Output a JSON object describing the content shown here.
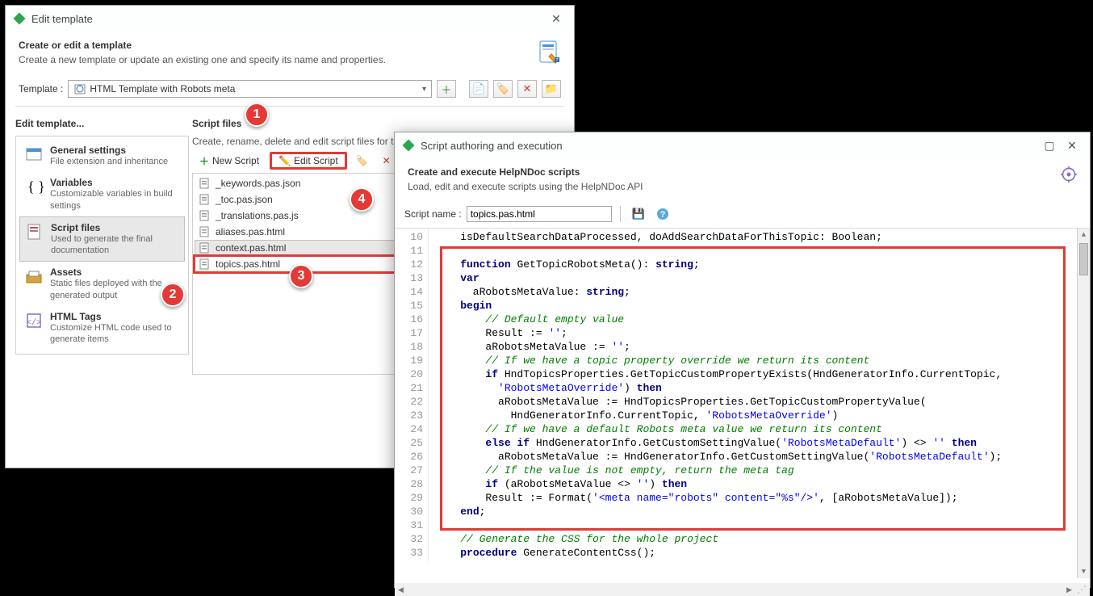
{
  "window1": {
    "title": "Edit template",
    "header": {
      "title": "Create or edit a template",
      "subtitle": "Create a new template or update an existing one and specify its name and properties."
    },
    "template_label": "Template :",
    "template_value": "HTML Template with Robots meta",
    "left_section_title": "Edit template...",
    "nav": [
      {
        "label": "General settings",
        "desc": "File extension and inheritance"
      },
      {
        "label": "Variables",
        "desc": "Customizable variables in build settings"
      },
      {
        "label": "Script files",
        "desc": "Used to generate the final documentation",
        "selected": true
      },
      {
        "label": "Assets",
        "desc": "Static files deployed with the generated output"
      },
      {
        "label": "HTML Tags",
        "desc": "Customize HTML code used to generate items"
      }
    ],
    "right_section_title": "Script files",
    "right_section_desc": "Create, rename, delete and edit script files for th",
    "new_script_btn": "New Script",
    "edit_script_btn": "Edit Script",
    "files": [
      "_keywords.pas.json",
      "_toc.pas.json",
      "_translations.pas.js",
      "aliases.pas.html",
      "context.pas.html",
      "topics.pas.html"
    ]
  },
  "window2": {
    "title": "Script authoring and execution",
    "header": {
      "title": "Create and execute HelpNDoc scripts",
      "subtitle": "Load, edit and execute scripts using the HelpNDoc API"
    },
    "script_name_label": "Script name :",
    "script_name_value": "topics.pas.html",
    "line_start": 10,
    "code_lines": [
      [
        {
          "t": "    isDefaultSearchDataProcessed, doAddSearchDataForThisTopic: Boolean;"
        }
      ],
      [],
      [
        {
          "t": "    "
        },
        {
          "c": "kw",
          "t": "function"
        },
        {
          "t": " GetTopicRobotsMeta(): "
        },
        {
          "c": "kw",
          "t": "string"
        },
        {
          "t": ";"
        }
      ],
      [
        {
          "t": "    "
        },
        {
          "c": "kw",
          "t": "var"
        }
      ],
      [
        {
          "t": "      aRobotsMetaValue: "
        },
        {
          "c": "kw",
          "t": "string"
        },
        {
          "t": ";"
        }
      ],
      [
        {
          "t": "    "
        },
        {
          "c": "kw",
          "t": "begin"
        }
      ],
      [
        {
          "t": "        "
        },
        {
          "c": "com",
          "t": "// Default empty value"
        }
      ],
      [
        {
          "t": "        Result := "
        },
        {
          "c": "str",
          "t": "''"
        },
        {
          "t": ";"
        }
      ],
      [
        {
          "t": "        aRobotsMetaValue := "
        },
        {
          "c": "str",
          "t": "''"
        },
        {
          "t": ";"
        }
      ],
      [
        {
          "t": "        "
        },
        {
          "c": "com",
          "t": "// If we have a topic property override we return its content"
        }
      ],
      [
        {
          "t": "        "
        },
        {
          "c": "kw",
          "t": "if"
        },
        {
          "t": " HndTopicsProperties.GetTopicCustomPropertyExists(HndGeneratorInfo.CurrentTopic,"
        }
      ],
      [
        {
          "t": "          "
        },
        {
          "c": "str",
          "t": "'RobotsMetaOverride'"
        },
        {
          "t": ") "
        },
        {
          "c": "kw",
          "t": "then"
        }
      ],
      [
        {
          "t": "          aRobotsMetaValue := HndTopicsProperties.GetTopicCustomPropertyValue("
        }
      ],
      [
        {
          "t": "            HndGeneratorInfo.CurrentTopic, "
        },
        {
          "c": "str",
          "t": "'RobotsMetaOverride'"
        },
        {
          "t": ")"
        }
      ],
      [
        {
          "t": "        "
        },
        {
          "c": "com",
          "t": "// If we have a default Robots meta value we return its content"
        }
      ],
      [
        {
          "t": "        "
        },
        {
          "c": "kw",
          "t": "else if"
        },
        {
          "t": " HndGeneratorInfo.GetCustomSettingValue("
        },
        {
          "c": "str",
          "t": "'RobotsMetaDefault'"
        },
        {
          "t": ") <> "
        },
        {
          "c": "str",
          "t": "''"
        },
        {
          "t": " "
        },
        {
          "c": "kw",
          "t": "then"
        }
      ],
      [
        {
          "t": "          aRobotsMetaValue := HndGeneratorInfo.GetCustomSettingValue("
        },
        {
          "c": "str",
          "t": "'RobotsMetaDefault'"
        },
        {
          "t": ");"
        }
      ],
      [
        {
          "t": "        "
        },
        {
          "c": "com",
          "t": "// If the value is not empty, return the meta tag"
        }
      ],
      [
        {
          "t": "        "
        },
        {
          "c": "kw",
          "t": "if"
        },
        {
          "t": " (aRobotsMetaValue <> "
        },
        {
          "c": "str",
          "t": "''"
        },
        {
          "t": ") "
        },
        {
          "c": "kw",
          "t": "then"
        }
      ],
      [
        {
          "t": "        Result := Format("
        },
        {
          "c": "str",
          "t": "'<meta name=\"robots\" content=\"%s\"/>'"
        },
        {
          "t": ", [aRobotsMetaValue]);"
        }
      ],
      [
        {
          "t": "    "
        },
        {
          "c": "kw",
          "t": "end"
        },
        {
          "t": ";"
        }
      ],
      [],
      [
        {
          "t": "    "
        },
        {
          "c": "com",
          "t": "// Generate the CSS for the whole project"
        }
      ],
      [
        {
          "t": "    "
        },
        {
          "c": "kw",
          "t": "procedure"
        },
        {
          "t": " GenerateContentCss();"
        }
      ]
    ]
  },
  "badges": {
    "b1": "1",
    "b2": "2",
    "b3": "3",
    "b4": "4"
  }
}
